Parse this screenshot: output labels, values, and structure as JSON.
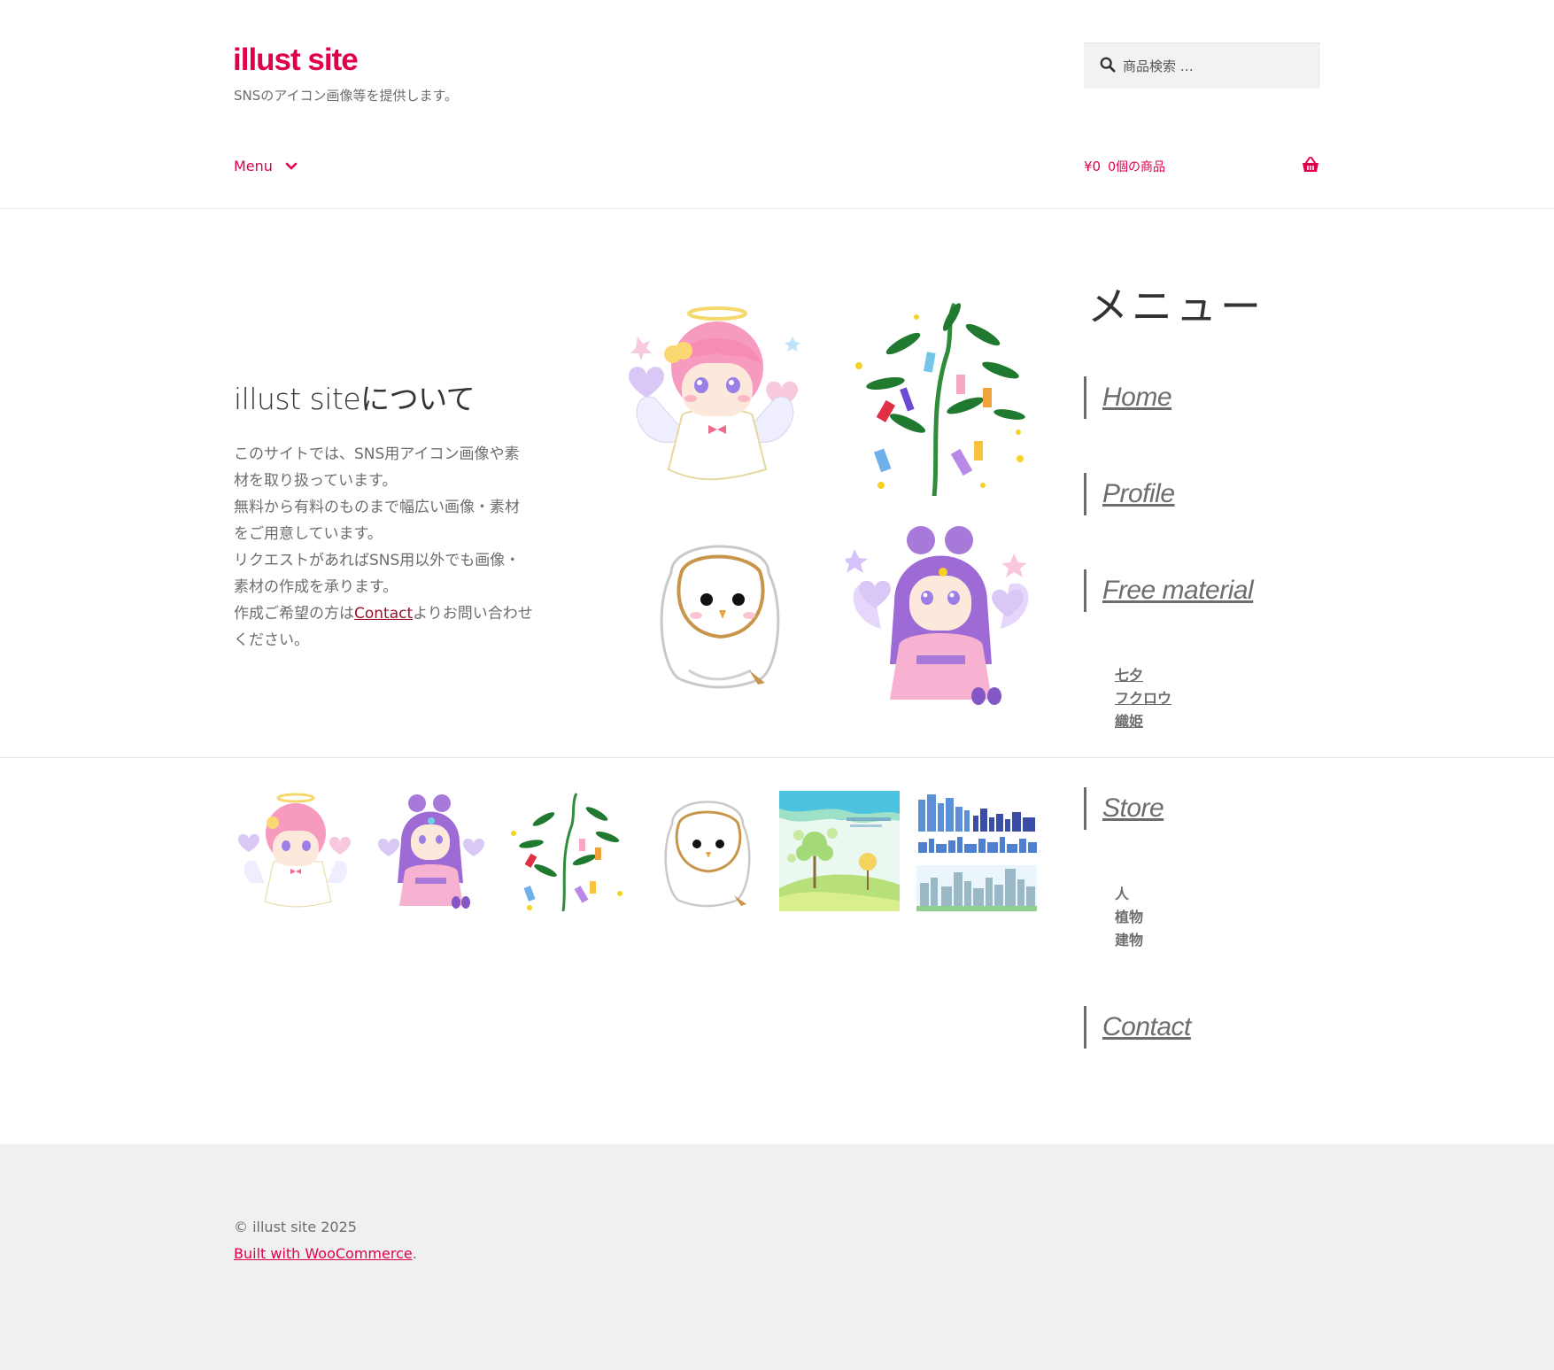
{
  "site": {
    "title": "illust site",
    "tagline": "SNSのアイコン画像等を提供します。",
    "brand_color": "#e0004a"
  },
  "search": {
    "placeholder": "商品検索 …",
    "icon": "search-icon"
  },
  "nav": {
    "menu_label": "Menu",
    "menu_icon": "chevron-down-icon"
  },
  "cart": {
    "amount": "¥0",
    "count_label": "0個の商品",
    "icon": "basket-icon"
  },
  "about": {
    "title": "illust siteについて",
    "lines": [
      "このサイトでは、SNS用アイコン画像や素",
      "材を取り扱っています。",
      "無料から有料のものまで幅広い画像・素材",
      "をご用意しています。",
      "リクエストがあればSNS用以外でも画像・",
      "素材の作成を承ります。"
    ],
    "contact_prefix": "作成ご希望の方は",
    "contact_link": "Contact",
    "contact_suffix": "よりお問い合わせ",
    "last_line": "ください。"
  },
  "gallery": {
    "main_images": [
      "angel-illustration",
      "tanabata-bamboo-illustration",
      "owl-illustration",
      "orihime-illustration"
    ],
    "thumbnails": [
      "angel-thumbnail",
      "orihime-thumbnail",
      "tanabata-thumbnail",
      "owl-thumbnail",
      "tree-landscape-thumbnail",
      "city-skyline-thumbnail"
    ]
  },
  "sidebar": {
    "title": "メニュー",
    "links": {
      "home": "Home",
      "profile": "Profile",
      "free_material": "Free material",
      "store": "Store",
      "contact": "Contact"
    },
    "free_sub": [
      "七夕",
      "フクロウ",
      "織姫"
    ],
    "store_sub": [
      "人",
      "植物",
      "建物"
    ]
  },
  "footer": {
    "copyright": "© illust site 2025",
    "built_with": "Built with WooCommerce",
    "built_suffix": "."
  }
}
